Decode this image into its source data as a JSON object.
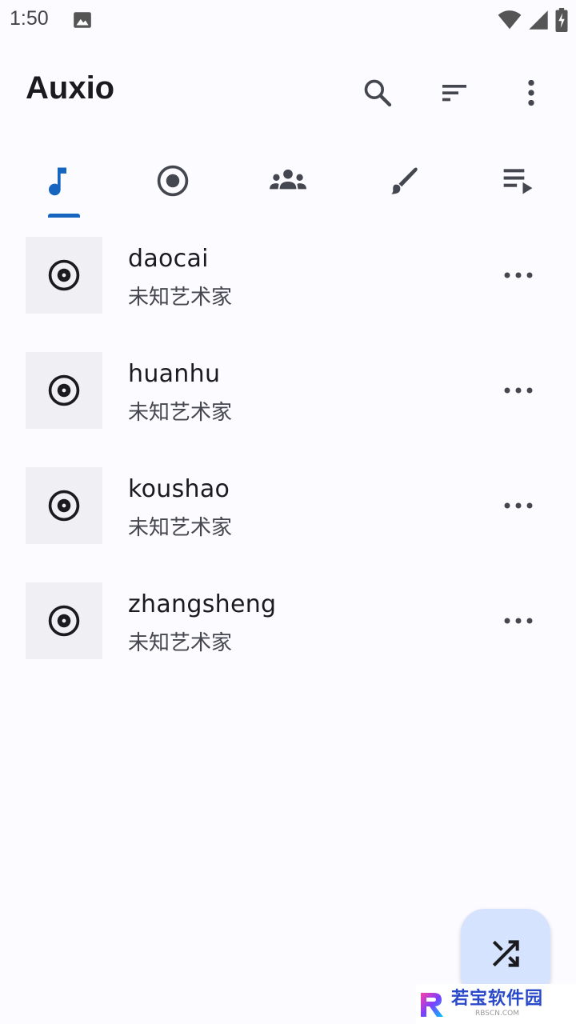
{
  "status_bar": {
    "time": "1:50",
    "icons": [
      "photo-icon",
      "wifi-icon",
      "signal-icon",
      "battery-charging-icon"
    ]
  },
  "app_bar": {
    "title": "Auxio",
    "actions": [
      "search-icon",
      "sort-icon",
      "more-vert-icon"
    ]
  },
  "tabs": [
    {
      "name": "songs",
      "icon": "music-note-icon",
      "selected": true
    },
    {
      "name": "albums",
      "icon": "album-icon",
      "selected": false
    },
    {
      "name": "artists",
      "icon": "people-icon",
      "selected": false
    },
    {
      "name": "genres",
      "icon": "brush-icon",
      "selected": false
    },
    {
      "name": "playlists",
      "icon": "playlist-play-icon",
      "selected": false
    }
  ],
  "songs": [
    {
      "title": "daocai",
      "artist": "未知艺术家"
    },
    {
      "title": "huanhu",
      "artist": "未知艺术家"
    },
    {
      "title": "koushao",
      "artist": "未知艺术家"
    },
    {
      "title": "zhangsheng",
      "artist": "未知艺术家"
    }
  ],
  "fab": {
    "icon": "shuffle-icon"
  },
  "watermark": {
    "text": "若宝软件园",
    "sub": "RBSCN.COM"
  },
  "colors": {
    "accent": "#1565c0",
    "background": "#fcfbff",
    "fab": "#d6e3ff",
    "art_bg": "#f0f0f4",
    "icon": "#44474f"
  }
}
